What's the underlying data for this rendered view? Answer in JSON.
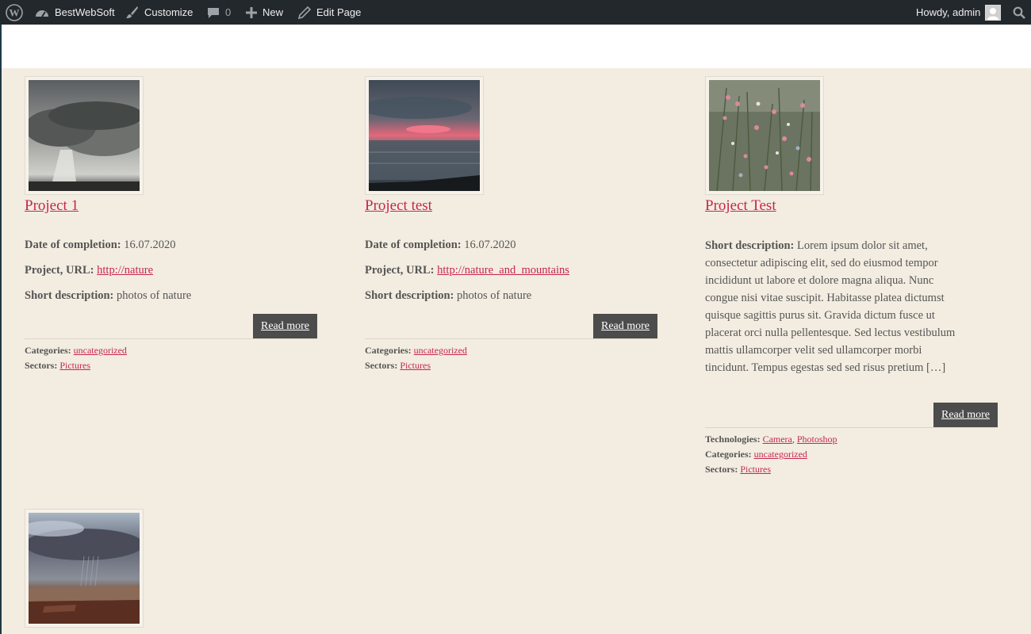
{
  "adminbar": {
    "site_name": "BestWebSoft",
    "customize": "Customize",
    "comments_count": "0",
    "new": "New",
    "edit_page": "Edit Page",
    "howdy": "Howdy, admin"
  },
  "labels": {
    "date": "Date of completion:",
    "url": "Project, URL:",
    "short_desc": "Short description:",
    "technologies": "Technologies:",
    "categories": "Categories:",
    "sectors": "Sectors:",
    "read_more": "Read more"
  },
  "projects": [
    {
      "title": "Project 1",
      "date": "16.07.2020",
      "url": "http://nature",
      "short_desc": "photos of nature",
      "category": "uncategorized",
      "sector": "Pictures"
    },
    {
      "title": "Project test",
      "date": "16.07.2020",
      "url": "http://nature_and_mountains",
      "short_desc": "photos of nature",
      "category": "uncategorized",
      "sector": "Pictures"
    },
    {
      "title": "Project Test",
      "short_desc": "Lorem ipsum dolor sit amet, consectetur adipiscing elit, sed do eiusmod tempor incididunt ut labore et dolore magna aliqua. Nunc congue nisi vitae suscipit. Habitasse platea dictumst quisque sagittis purus sit. Gravida dictum fusce ut placerat orci nulla pellentesque. Sed lectus vestibulum mattis ullamcorper velit sed ullamcorper morbi tincidunt. Tempus egestas sed sed risus pretium […]",
      "tech1": "Camera",
      "tech2": "Photoshop",
      "category": "uncategorized",
      "sector": "Pictures"
    }
  ]
}
